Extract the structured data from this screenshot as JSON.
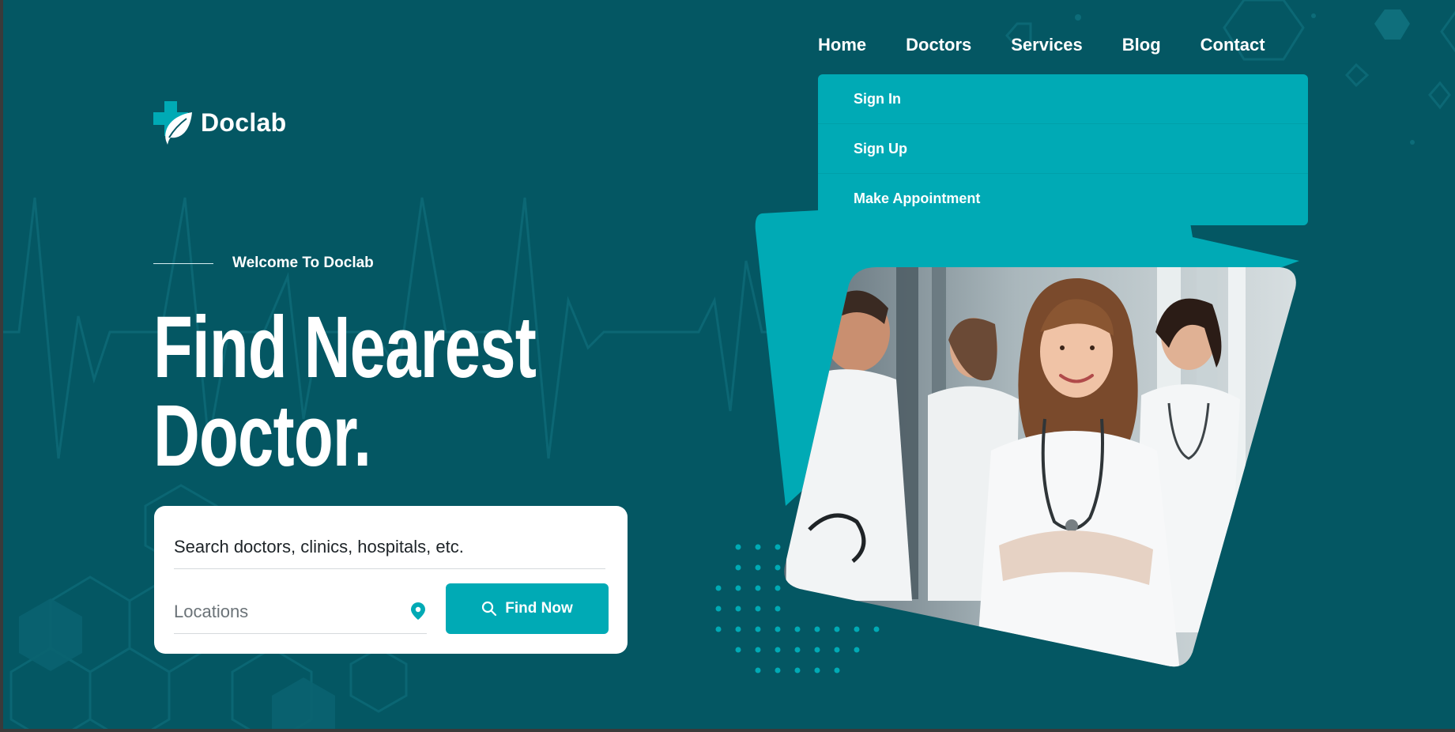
{
  "brand": {
    "name": "Doclab",
    "accent": "#00aab5",
    "background": "#045763"
  },
  "nav": {
    "items": [
      {
        "label": "Home"
      },
      {
        "label": "Doctors"
      },
      {
        "label": "Services"
      },
      {
        "label": "Blog"
      },
      {
        "label": "Contact"
      }
    ],
    "dropdown": [
      {
        "label": "Sign In"
      },
      {
        "label": "Sign Up"
      },
      {
        "label": "Make Appointment"
      }
    ]
  },
  "hero": {
    "welcome": "Welcome To Doclab",
    "headline_line1": "Find Nearest",
    "headline_line2": "Doctor."
  },
  "search": {
    "query_placeholder": "Search doctors, clinics, hospitals, etc.",
    "location_placeholder": "Locations",
    "button_label": "Find Now",
    "button_icon": "search-icon",
    "location_icon": "map-pin-icon"
  },
  "image": {
    "subject": "doctors-photo"
  }
}
